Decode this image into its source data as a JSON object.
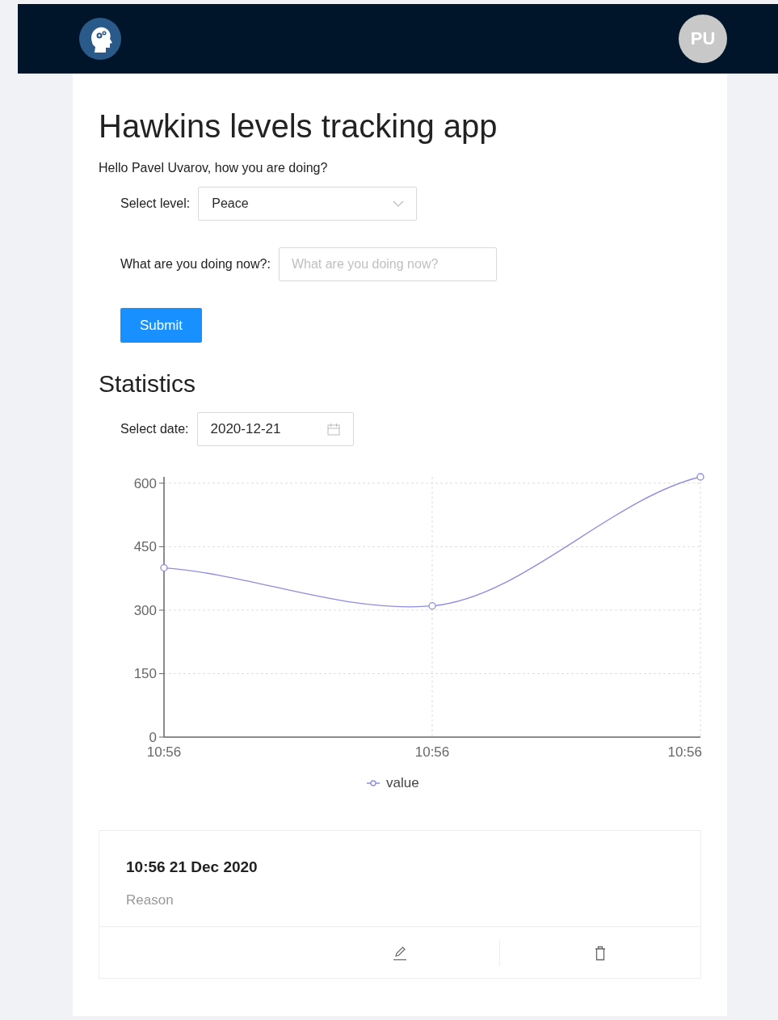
{
  "header": {
    "avatar": "PU"
  },
  "title": "Hawkins levels tracking app",
  "greeting": "Hello Pavel Uvarov, how you are doing?",
  "form": {
    "level": {
      "label": "Select level:",
      "value": "Peace"
    },
    "activity": {
      "label": "What are you doing now?:",
      "placeholder": "What are you doing now?"
    },
    "submit": "Submit"
  },
  "statistics": {
    "heading": "Statistics",
    "date": {
      "label": "Select date:",
      "value": "2020-12-21"
    },
    "chart_data": {
      "type": "line",
      "categories": [
        "10:56",
        "10:56",
        "10:56"
      ],
      "series": [
        {
          "name": "value",
          "color": "#8e8be0",
          "marker": "circle",
          "values": [
            400,
            310,
            615
          ]
        }
      ],
      "grid": true,
      "ylim": [
        0,
        615
      ],
      "yticks": [
        0,
        150,
        300,
        450,
        600
      ]
    }
  },
  "entries": [
    {
      "time": "10:56 21 Dec 2020",
      "reason": "Reason"
    }
  ]
}
